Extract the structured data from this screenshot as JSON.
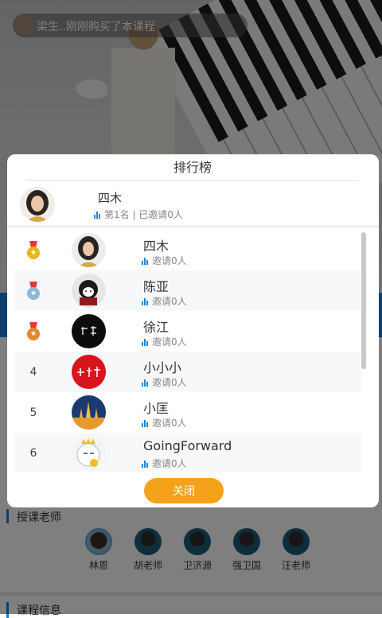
{
  "notification": {
    "text": "梁生..刚刚购买了本课程"
  },
  "background": {
    "teachers_title": "授课老师",
    "teachers": [
      {
        "name": "林恩"
      },
      {
        "name": "胡老师"
      },
      {
        "name": "卫济源"
      },
      {
        "name": "强卫国"
      },
      {
        "name": "汪老师"
      }
    ],
    "course_info_title": "课程信息"
  },
  "modal": {
    "title": "排行榜",
    "me": {
      "name": "四木",
      "stats": "第1名 | 已邀请0人"
    },
    "rows": [
      {
        "rank": "",
        "medal": "gold",
        "name": "四木",
        "invited": "邀请0人"
      },
      {
        "rank": "",
        "medal": "silver",
        "name": "陈亚",
        "invited": "邀请0人"
      },
      {
        "rank": "",
        "medal": "bronze",
        "name": "徐江",
        "invited": "邀请0人"
      },
      {
        "rank": "4",
        "medal": "",
        "name": "小小小",
        "invited": "邀请0人"
      },
      {
        "rank": "5",
        "medal": "",
        "name": "小匡",
        "invited": "邀请0人"
      },
      {
        "rank": "6",
        "medal": "",
        "name": "GoingForward",
        "invited": "邀请0人"
      }
    ],
    "close_label": "关闭"
  },
  "colors": {
    "accent_blue": "#1a88d9",
    "close_button": "#f5a21b",
    "gold_medal": "#e8b61c",
    "silver_medal": "#8fb8d8",
    "bronze_medal": "#e3892b"
  }
}
